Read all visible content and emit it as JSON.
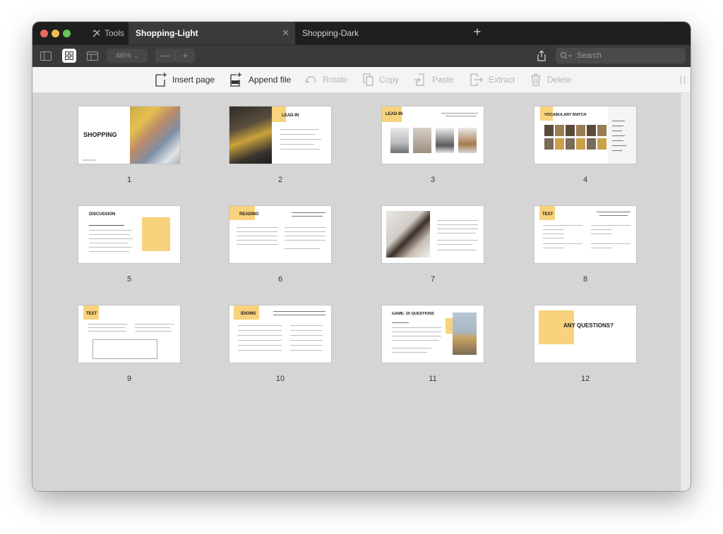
{
  "tabs": {
    "tools_label": "Tools",
    "active_label": "Shopping-Light",
    "inactive_label": "Shopping-Dark",
    "close_glyph": "✕",
    "new_tab_glyph": "+"
  },
  "toolbar": {
    "zoom_value": "46%",
    "zoom_minus": "—",
    "zoom_plus": "+",
    "search_placeholder": "Search"
  },
  "actions": [
    {
      "label": "Insert page",
      "enabled": true,
      "icon": "insert-page-icon"
    },
    {
      "label": "Append file",
      "enabled": true,
      "icon": "append-file-icon"
    },
    {
      "label": "Rotate",
      "enabled": false,
      "icon": "rotate-icon"
    },
    {
      "label": "Copy",
      "enabled": false,
      "icon": "copy-icon"
    },
    {
      "label": "Paste",
      "enabled": false,
      "icon": "paste-icon"
    },
    {
      "label": "Extract",
      "enabled": false,
      "icon": "extract-icon"
    },
    {
      "label": "Delete",
      "enabled": false,
      "icon": "trash-icon"
    }
  ],
  "pages": [
    {
      "number": "1",
      "title": "SHOPPING"
    },
    {
      "number": "2",
      "title": "LEAD-IN"
    },
    {
      "number": "3",
      "title": "LEAD-IN"
    },
    {
      "number": "4",
      "title": "VOCABULARY MATCH"
    },
    {
      "number": "5",
      "title": "DISCUSSION"
    },
    {
      "number": "6",
      "title": "READING"
    },
    {
      "number": "7",
      "title": ""
    },
    {
      "number": "8",
      "title": "TEST"
    },
    {
      "number": "9",
      "title": "TEST"
    },
    {
      "number": "10",
      "title": "IDIOMS"
    },
    {
      "number": "11",
      "title": "GAME: 20 QUESTIONS"
    },
    {
      "number": "12",
      "title": "ANY QUESTIONS?"
    }
  ],
  "colors": {
    "accent_yellow": "#f8d27c",
    "tabbar_bg": "#1f1f1f",
    "toolbar_bg": "#3a3a3a",
    "canvas_bg": "#d5d5d5"
  }
}
